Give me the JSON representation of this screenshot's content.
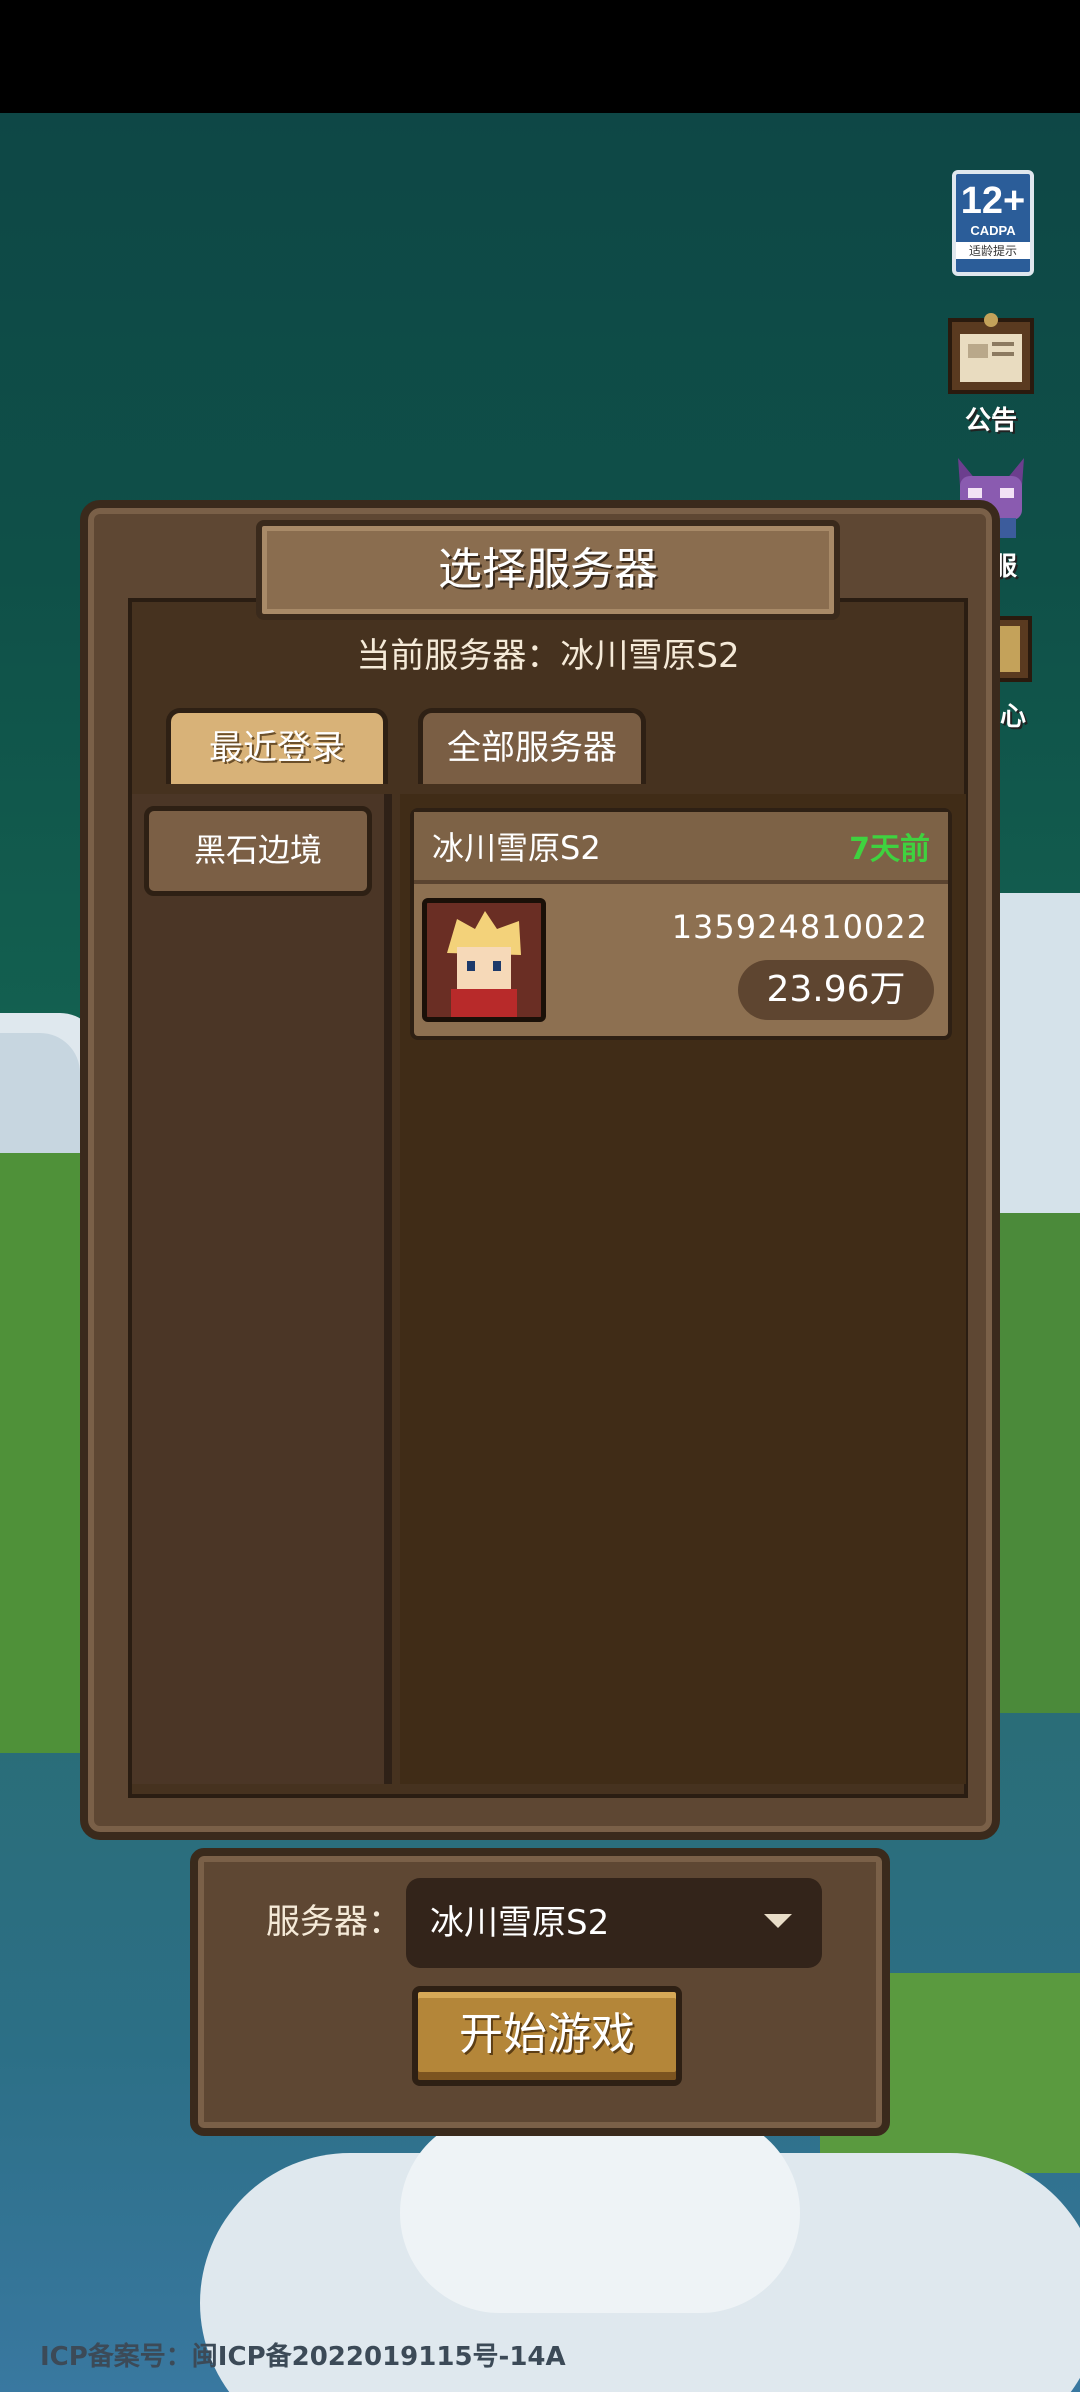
{
  "side_icons": {
    "age_rating": {
      "big": "12+",
      "org": "CADPA",
      "note": "适龄提示"
    },
    "notice": "公告",
    "support": "客服",
    "center": "中心"
  },
  "dialog": {
    "title": "选择服务器",
    "current_server": "当前服务器：冰川雪原S2",
    "tabs": [
      {
        "label": "最近登录",
        "active": true
      },
      {
        "label": "全部服务器",
        "active": false
      }
    ],
    "regions": [
      "黑石边境"
    ],
    "server_card": {
      "name": "冰川雪原S2",
      "last_login": "7天前",
      "uid": "135924810022",
      "power": "23.96万"
    }
  },
  "bottom": {
    "server_label": "服务器：",
    "selected_server": "冰川雪原S2",
    "start_button": "开始游戏"
  },
  "footer": {
    "icp": "ICP备案号：闽ICP备2022019115号-14A"
  },
  "colors": {
    "panel": "#5e4733",
    "panel_border": "#3a2a1c",
    "tab_active": "#d8b278",
    "time_green": "#3fd23f",
    "start_button": "#b48639"
  }
}
